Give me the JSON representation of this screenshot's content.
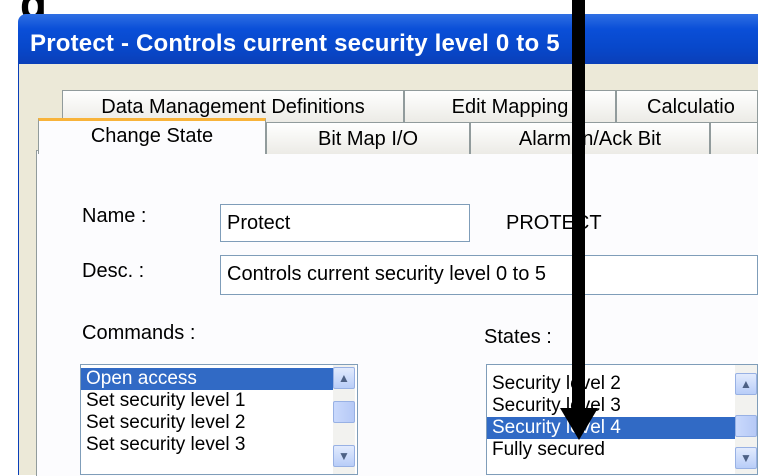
{
  "window": {
    "title": "Protect - Controls current security level 0 to 5"
  },
  "tabs_row_back": [
    {
      "label": "Data Management Definitions"
    },
    {
      "label": "Edit Mapping"
    },
    {
      "label": "Calculatio"
    }
  ],
  "tabs_row_front": [
    {
      "label": "Change State",
      "active": true
    },
    {
      "label": "Bit Map I/O"
    },
    {
      "label": "Alarm In/Ack Bit"
    }
  ],
  "form": {
    "name_label": "Name :",
    "name_value": "Protect",
    "name_upper": "PROTECT",
    "desc_label": "Desc. :",
    "desc_value": "Controls current security level 0 to 5"
  },
  "commands": {
    "label": "Commands :",
    "items": [
      "Open access",
      "Set security level 1",
      "Set security level 2",
      "Set security level 3"
    ],
    "selected_index": 0
  },
  "states": {
    "label": "States :",
    "items": [
      "Security level 2",
      "Security level 3",
      "Security level 4",
      "Fully secured"
    ],
    "selected_index": 2
  },
  "colors": {
    "title_bar": "#0a4fd8",
    "selection": "#316ac5",
    "tab_highlight": "#f8b33a",
    "dialog_bg": "#ece9d8"
  },
  "icons": {
    "scroll_up": "chevron-up-icon",
    "scroll_down": "chevron-down-icon",
    "annotation": "down-arrow-icon"
  }
}
